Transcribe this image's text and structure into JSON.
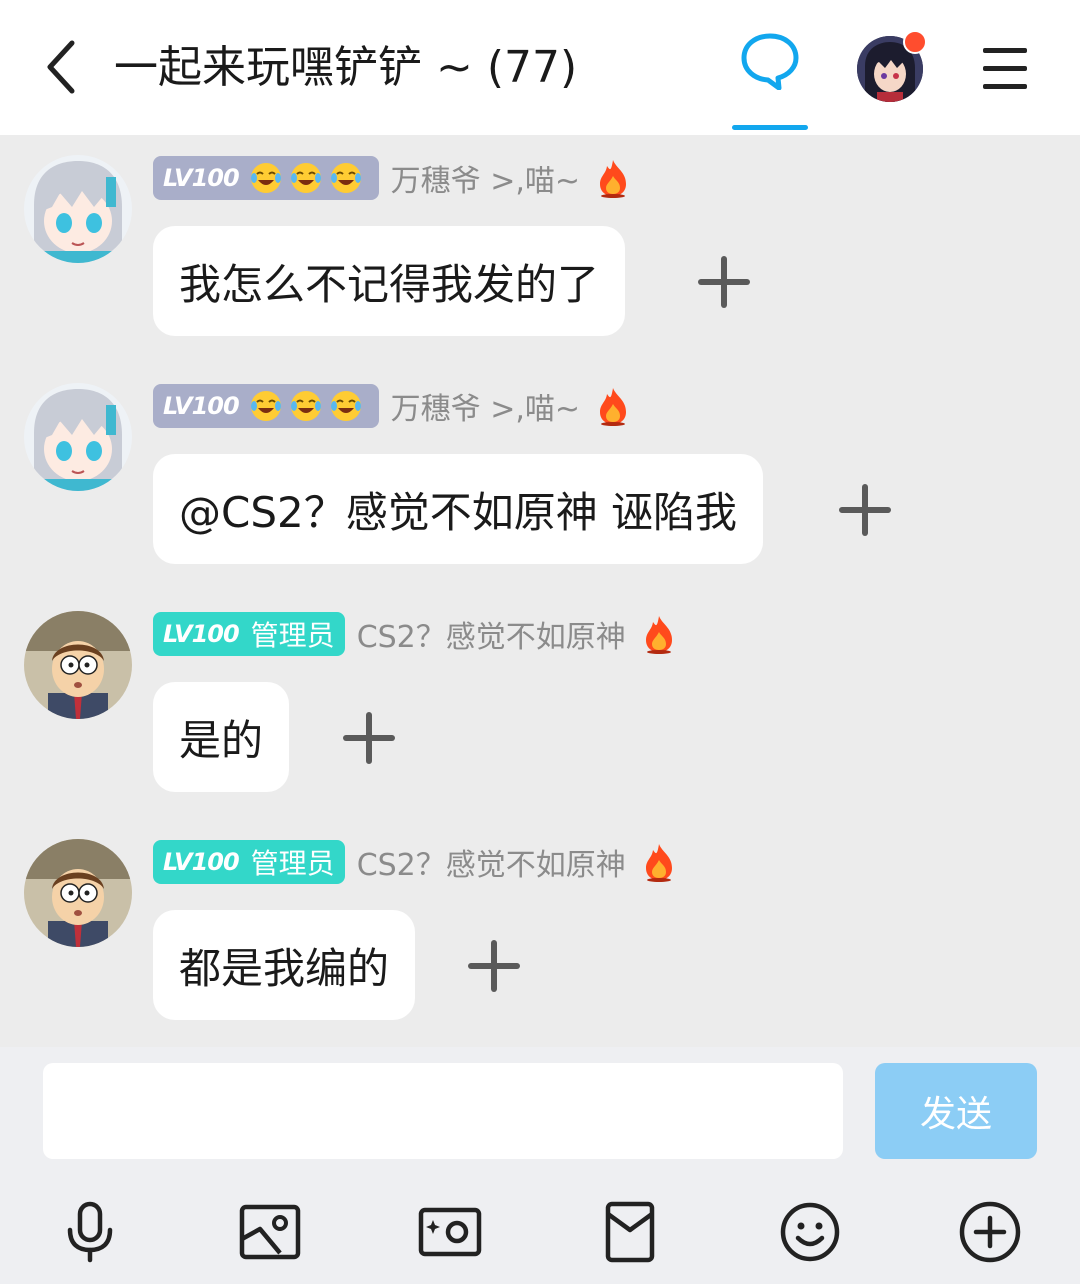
{
  "header": {
    "title": "一起来玩嘿铲铲 ~ (77)",
    "accent_color": "#12a7ee",
    "notification_dot_color": "#ff4d2e"
  },
  "messages": [
    {
      "level": "LV100",
      "badge_type": "emoji",
      "badge_color": "#a9aec9",
      "nickname": "万穗爷 >,喵~",
      "text": "我怎么不记得我发的了",
      "avatar": "anime-girl-avatar"
    },
    {
      "level": "LV100",
      "badge_type": "emoji",
      "badge_color": "#a9aec9",
      "nickname": "万穗爷 >,喵~",
      "text": "@CS2？感觉不如原神 诬陷我",
      "avatar": "anime-girl-avatar"
    },
    {
      "level": "LV100",
      "badge_type": "role",
      "role": "管理员",
      "badge_color": "#33d7c9",
      "nickname": "CS2？感觉不如原神",
      "text": "是的",
      "avatar": "cartoon-boy-avatar"
    },
    {
      "level": "LV100",
      "badge_type": "role",
      "role": "管理员",
      "badge_color": "#33d7c9",
      "nickname": "CS2？感觉不如原神",
      "text": "都是我编的",
      "avatar": "cartoon-boy-avatar"
    }
  ],
  "composer": {
    "input_value": "",
    "send_label": "发送",
    "send_color": "#8ccdf5"
  },
  "toolbar": {
    "icons": [
      "microphone-icon",
      "image-icon",
      "camera-icon",
      "red-packet-icon",
      "emoji-icon",
      "plus-circle-icon"
    ]
  }
}
